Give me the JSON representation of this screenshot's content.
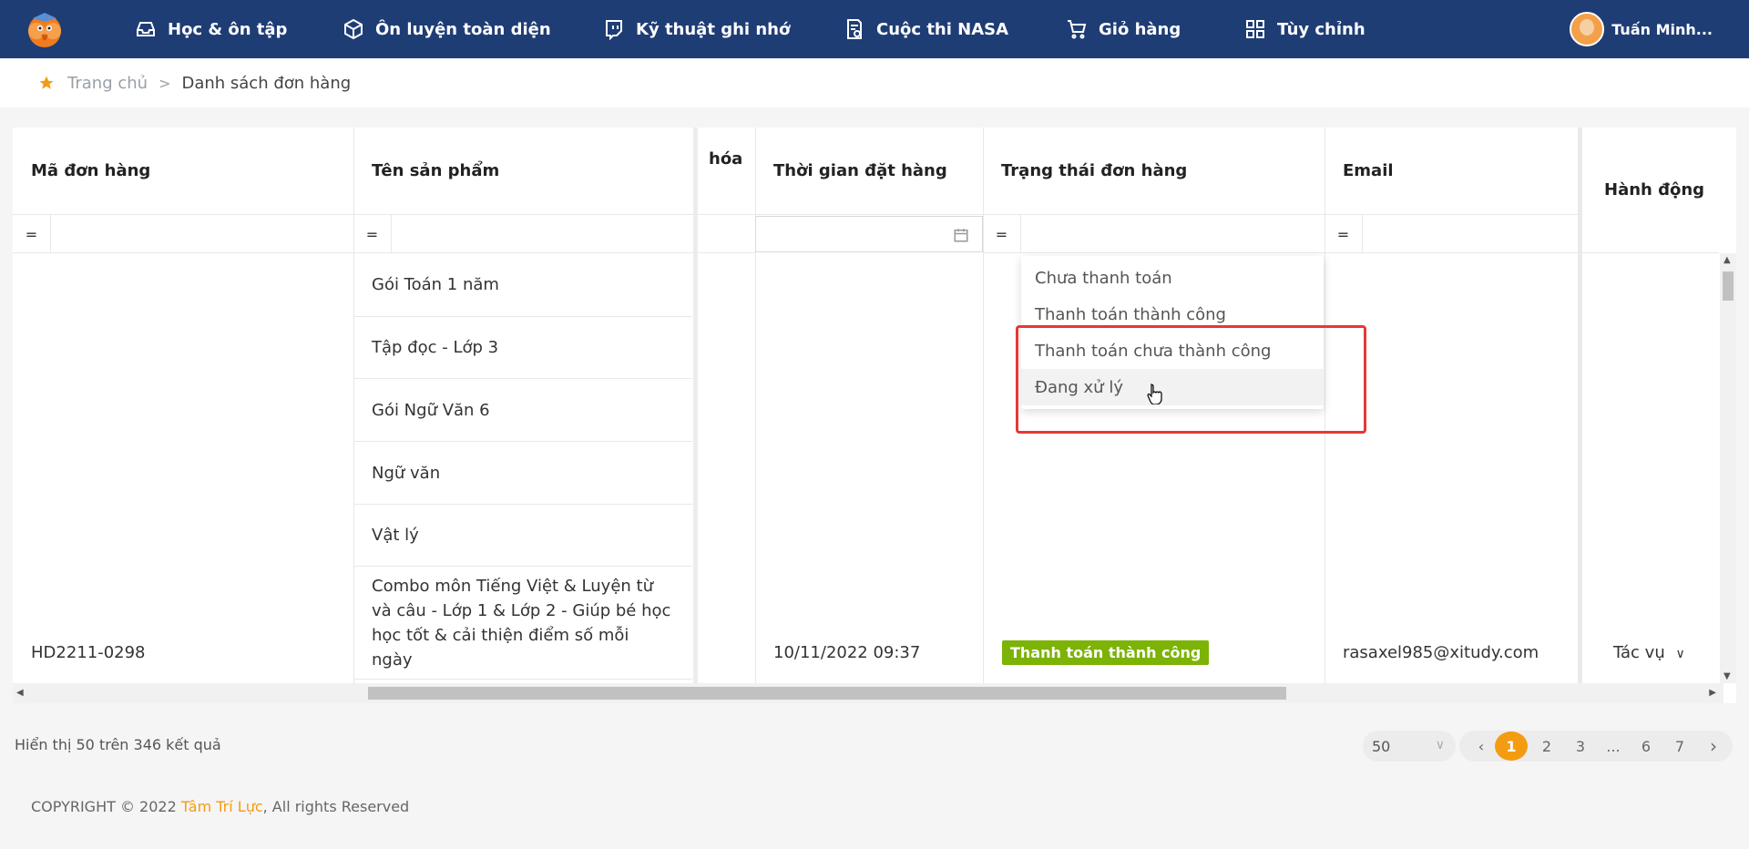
{
  "nav": {
    "items": [
      {
        "label": "Học & ôn tập",
        "icon": "inbox-icon"
      },
      {
        "label": "Ôn luyện toàn diện",
        "icon": "cube-icon"
      },
      {
        "label": "Kỹ thuật ghi nhớ",
        "icon": "twitch-icon"
      },
      {
        "label": "Cuộc thi NASA",
        "icon": "document-icon"
      },
      {
        "label": "Giỏ hàng",
        "icon": "cart-icon"
      },
      {
        "label": "Tùy chỉnh",
        "icon": "grid-icon"
      }
    ],
    "user_name": "Tuấn Minh..."
  },
  "breadcrumb": {
    "home": "Trang chủ",
    "separator": ">",
    "current": "Danh sách đơn hàng"
  },
  "table": {
    "headers": {
      "order_code": "Mã đơn hàng",
      "product_name": "Tên sản phẩm",
      "hidden_partial": "hóa",
      "order_time": "Thời gian đặt hàng",
      "order_status": "Trạng thái đơn hàng",
      "email": "Email",
      "action": "Hành động"
    },
    "filter_operator": "=",
    "products": [
      "Gói Toán 1 năm",
      "Tập đọc - Lớp 3",
      "Gói Ngữ Văn 6",
      "Ngữ văn",
      "Vật lý",
      "Combo môn Tiếng Việt & Luyện từ và câu - Lớp 1 & Lớp 2 - Giúp bé học học tốt & cải thiện điểm số mỗi ngày"
    ],
    "row": {
      "order_code": "HD2211-0298",
      "order_time": "10/11/2022 09:37",
      "status": "Thanh toán thành công",
      "email": "rasaxel985@xitudy.com",
      "action": "Tác vụ"
    }
  },
  "status_dropdown": {
    "options": [
      "Chưa thanh toán",
      "Thanh toán thành công",
      "Thanh toán chưa thành công",
      "Đang xử lý"
    ]
  },
  "footer": {
    "result_text": "Hiển thị 50 trên 346 kết quả",
    "page_size": "50",
    "pages": [
      "1",
      "2",
      "3",
      "...",
      "6",
      "7"
    ],
    "copyright_prefix": "COPYRIGHT © 2022 ",
    "copyright_brand": "Tâm Trí Lực",
    "copyright_suffix": ", All rights Reserved"
  },
  "colors": {
    "nav_bg": "#1f3d75",
    "accent": "#f39c12",
    "success": "#7cb305",
    "highlight": "#e53935"
  }
}
